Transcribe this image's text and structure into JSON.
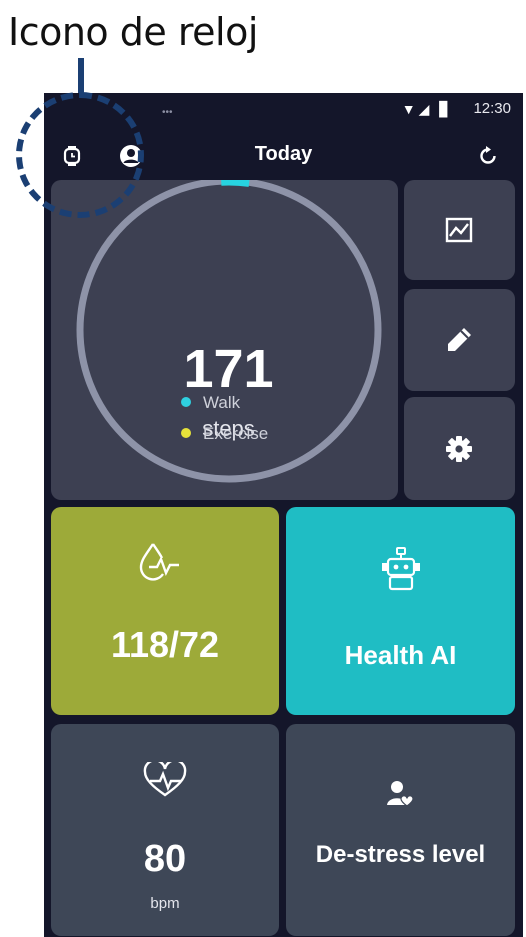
{
  "annotation": {
    "caption": "Icono de reloj"
  },
  "status_bar": {
    "time": "12:30",
    "signal_icons": "▼◢ ▊",
    "notification_dots": "•••"
  },
  "header": {
    "title": "Today"
  },
  "steps": {
    "value": "171",
    "label": "steps",
    "progress_fraction": 0.03
  },
  "legend": [
    {
      "label": "Walk",
      "color": "#2fd0e0"
    },
    {
      "label": "Exercise",
      "color": "#e6e23a"
    }
  ],
  "tiles": {
    "blood_pressure": {
      "value": "118/72"
    },
    "health_ai": {
      "label": "Health AI"
    },
    "heart_rate": {
      "value": "80",
      "unit": "bpm"
    },
    "destress": {
      "label": "De-stress level"
    }
  },
  "icons": {
    "watch": "watch-icon",
    "profile": "profile-icon",
    "refresh": "refresh-icon",
    "chart": "chart-icon",
    "edit": "pencil-icon",
    "settings": "gear-icon",
    "blood_pressure": "blood-drop-pulse-icon",
    "robot": "robot-icon",
    "heart": "heart-pulse-icon",
    "person": "person-heart-icon"
  },
  "colors": {
    "background": "#14162a",
    "tile": "#3d4052",
    "ring": "#8e93a8",
    "blood_pressure_tile": "#9daa39",
    "health_ai_tile": "#1fbdc4",
    "annotation_dash": "#1b3f73"
  }
}
